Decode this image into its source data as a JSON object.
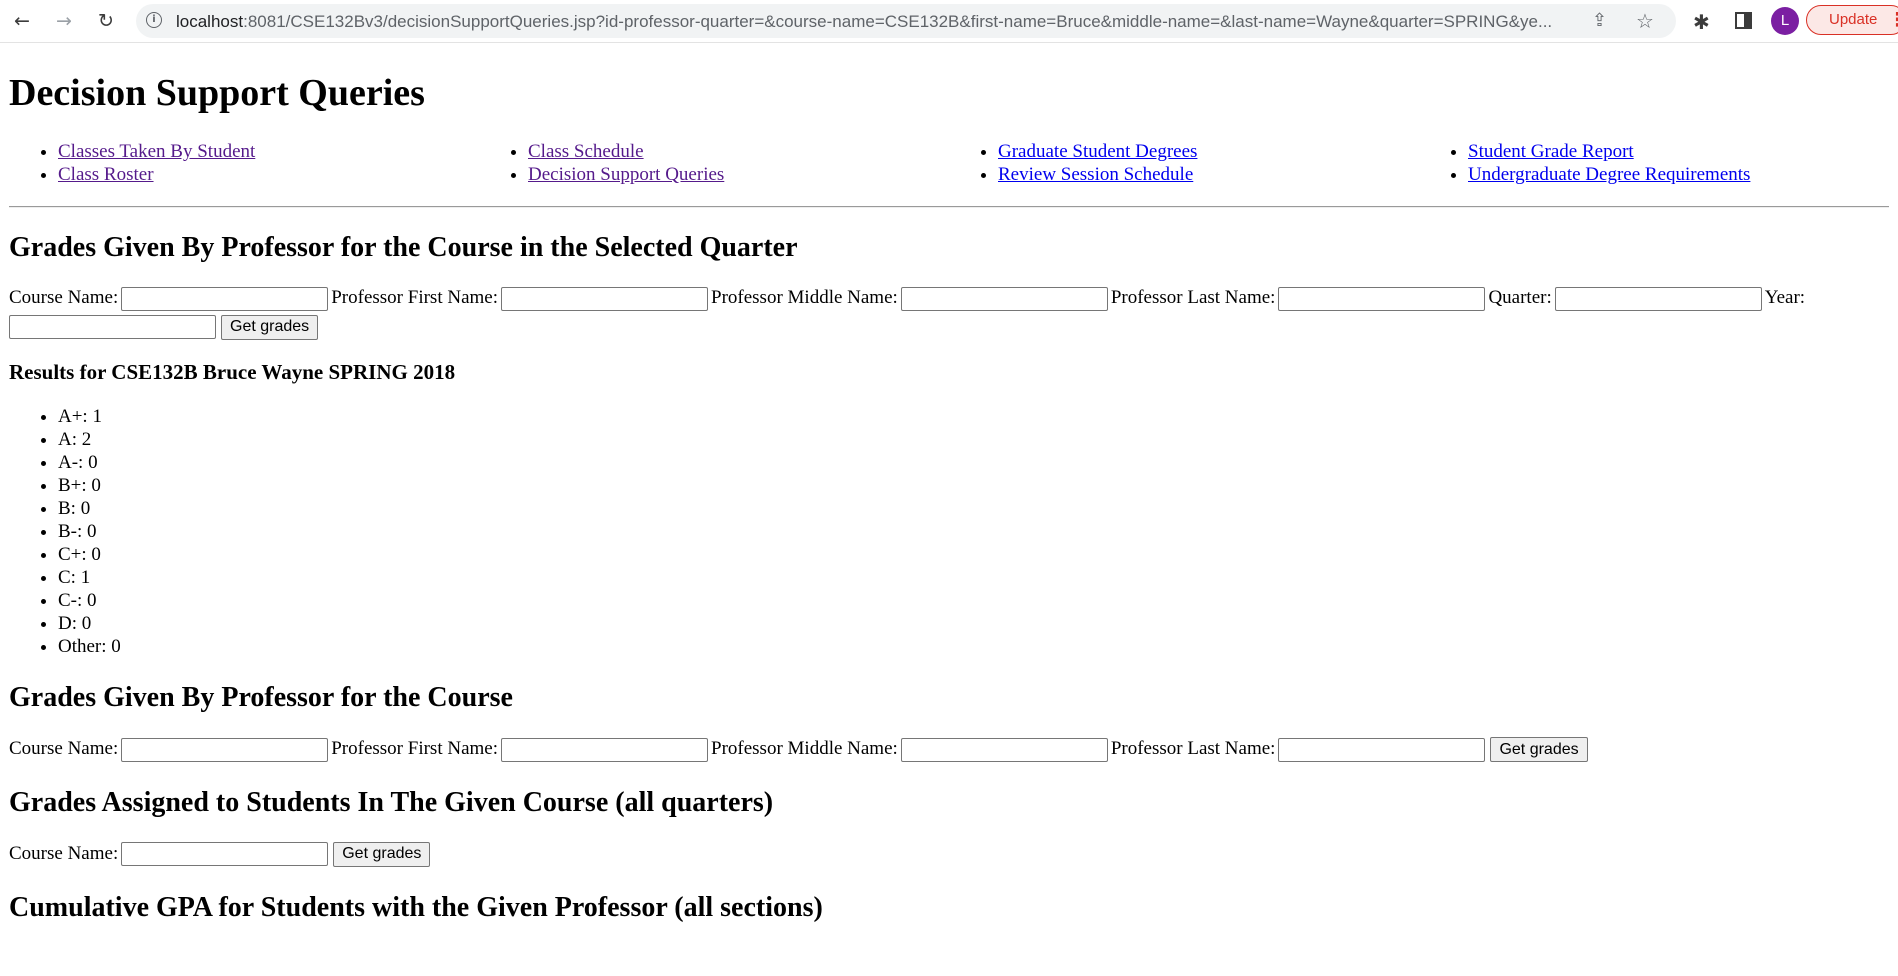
{
  "browser": {
    "url_host": "localhost",
    "url_rest": ":8081/CSE132Bv3/decisionSupportQueries.jsp?id-professor-quarter=&course-name=CSE132B&first-name=Bruce&middle-name=&last-name=Wayne&quarter=SPRING&ye...",
    "avatar_letter": "L",
    "update_label": "Update"
  },
  "page_title": "Decision Support Queries",
  "nav_columns": [
    [
      {
        "label": "Classes Taken By Student",
        "visited": true
      },
      {
        "label": "Class Roster",
        "visited": true
      }
    ],
    [
      {
        "label": "Class Schedule",
        "visited": true
      },
      {
        "label": "Decision Support Queries",
        "visited": true
      }
    ],
    [
      {
        "label": "Graduate Student Degrees",
        "visited": false
      },
      {
        "label": "Review Session Schedule",
        "visited": false
      }
    ],
    [
      {
        "label": "Student Grade Report",
        "visited": false
      },
      {
        "label": "Undergraduate Degree Requirements",
        "visited": false
      }
    ]
  ],
  "section1": {
    "title": "Grades Given By Professor for the Course in the Selected Quarter",
    "course_label": "Course Name:",
    "first_label": "Professor First Name:",
    "middle_label": "Professor Middle Name:",
    "last_label": "Professor Last Name:",
    "quarter_label": "Quarter:",
    "year_label": "Year:",
    "button": "Get grades",
    "results_title": "Results for CSE132B Bruce Wayne SPRING 2018",
    "results": [
      "A+: 1",
      "A: 2",
      "A-: 0",
      "B+: 0",
      "B: 0",
      "B-: 0",
      "C+: 0",
      "C: 1",
      "C-: 0",
      "D: 0",
      "Other: 0"
    ]
  },
  "section2": {
    "title": "Grades Given By Professor for the Course",
    "course_label": "Course Name:",
    "first_label": "Professor First Name:",
    "middle_label": "Professor Middle Name:",
    "last_label": "Professor Last Name:",
    "button": "Get grades"
  },
  "section3": {
    "title": "Grades Assigned to Students In The Given Course (all quarters)",
    "course_label": "Course Name:",
    "button": "Get grades"
  },
  "section4": {
    "title": "Cumulative GPA for Students with the Given Professor (all sections)"
  }
}
